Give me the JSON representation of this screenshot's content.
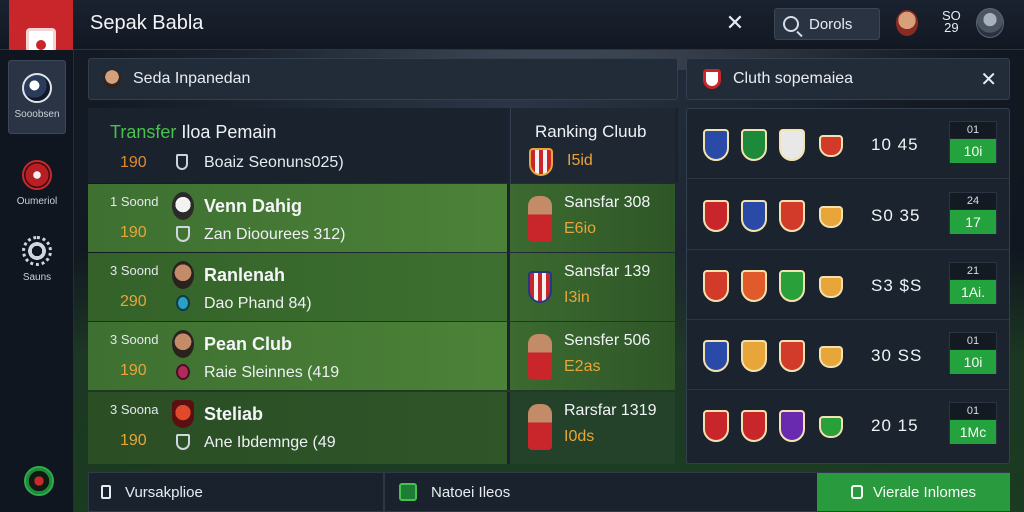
{
  "app": {
    "title": "Sepak Babla"
  },
  "topbar": {
    "search_label": "Dorols",
    "score": [
      "SO",
      "29"
    ]
  },
  "nav": [
    {
      "label": "Sooobsen",
      "icon": "soccer-ball-icon"
    },
    {
      "label": "Oumeriol",
      "icon": "match-icon"
    },
    {
      "label": "Sauns",
      "icon": "gear-icon"
    }
  ],
  "header_left": {
    "label": "Seda Inpanedan"
  },
  "header_right": {
    "label": "Cluth sopemaiea"
  },
  "transfer": {
    "title_green": "Transfer",
    "title_rest": "Iloa Pemain",
    "num": "190",
    "sub": "Boaiz Seonuns025)"
  },
  "ranking": {
    "title": "Ranking Cluub",
    "value": "I5id"
  },
  "players": [
    {
      "label": "1 Soond",
      "num": "190",
      "name": "Venn Dahig",
      "sub": "Zan Dioourees 312)",
      "side_name": "Sansfar 308",
      "side_sub": "E6io"
    },
    {
      "label": "3 Soond",
      "num": "290",
      "name": "Ranlenah",
      "sub": "Dao Phand 84)",
      "side_name": "Sansfar 139",
      "side_sub": "I3in"
    },
    {
      "label": "3 Soond",
      "num": "190",
      "name": "Pean Club",
      "sub": "Raie Sleinnes (419",
      "side_name": "Sensfer 506",
      "side_sub": "E2as"
    },
    {
      "label": "3 Soona",
      "num": "190",
      "name": "Steliab",
      "sub": "Ane Ibdemnge (49",
      "side_name": "Rarsfar 1319",
      "side_sub": "I0ds"
    }
  ],
  "rankings": [
    {
      "score": "10 45",
      "top": "01",
      "bottom": "10i",
      "colors": [
        "#2a4aa8",
        "#1c8a3a",
        "#e8e8e8",
        "#d23a2a"
      ]
    },
    {
      "score": "S0 35",
      "top": "24",
      "bottom": "17",
      "colors": [
        "#c8262a",
        "#2a4aa8",
        "#d23a2a",
        "#e8a53a"
      ]
    },
    {
      "score": "S3 $S",
      "top": "21",
      "bottom": "1Ai.",
      "colors": [
        "#d23a2a",
        "#e05a2a",
        "#2aa03a",
        "#e8a53a"
      ]
    },
    {
      "score": "30 SS",
      "top": "01",
      "bottom": "10i",
      "colors": [
        "#2a4aa8",
        "#e8a53a",
        "#d23a2a",
        "#e8a53a"
      ]
    },
    {
      "score": "20 15",
      "top": "01",
      "bottom": "1Mc",
      "colors": [
        "#c8262a",
        "#c8262a",
        "#6a2ab0",
        "#2aa03a"
      ]
    }
  ],
  "bottom": {
    "left": "Vursakplioe",
    "mid": "Natoei Ileos",
    "right": "Vierale Inlomes"
  }
}
